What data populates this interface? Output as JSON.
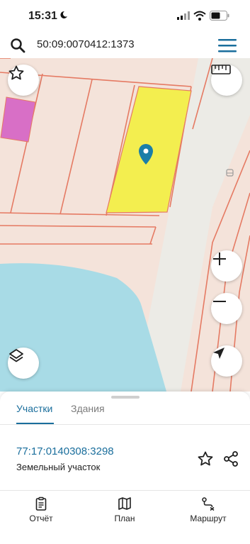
{
  "status_bar": {
    "time": "15:31"
  },
  "search": {
    "value": "50:09:0070412:1373"
  },
  "sheet": {
    "tabs": [
      "Участки",
      "Здания"
    ],
    "parcel": {
      "number": "77:17:0140308:3298",
      "type": "Земельный участок"
    }
  },
  "bottom_nav": {
    "report": "Отчёт",
    "plan": "План",
    "route": "Маршрут"
  },
  "icons": {
    "search": "search-icon",
    "menu": "hamburger-menu-icon",
    "favorite": "star-icon",
    "ruler": "ruler-icon",
    "layers": "layers-icon",
    "zoom_in": "plus-icon",
    "zoom_out": "minus-icon",
    "locate": "navigation-arrow-icon",
    "share": "share-icon",
    "report": "clipboard-icon",
    "plan": "map-icon",
    "route": "route-icon"
  },
  "colors": {
    "accent": "#1a6e9c",
    "selected_parcel": "#f3ee4f",
    "highlight_parcel": "#d86fc6",
    "water": "#a8dbe6",
    "parcel_border": "#e57a63"
  }
}
